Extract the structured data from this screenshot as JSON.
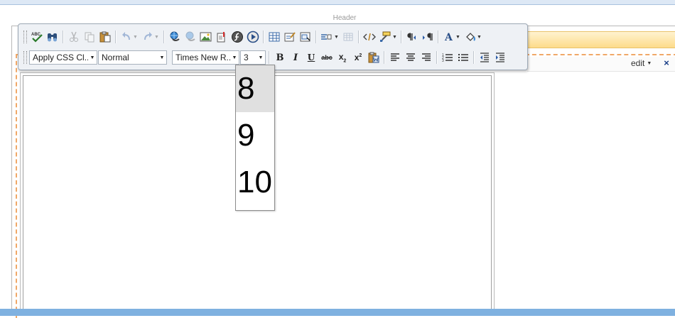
{
  "zone": {
    "header_label": "Header"
  },
  "webpart": {
    "edit_label": "edit",
    "close_symbol": "×"
  },
  "toolbar": {
    "row1_icons": [
      "spellcheck-icon",
      "find-replace-icon",
      "cut-icon",
      "copy-icon",
      "paste-icon",
      "undo-icon",
      "redo-icon",
      "hyperlink-icon",
      "remove-link-icon",
      "image-icon",
      "document-link-icon",
      "flash-icon",
      "media-icon",
      "table-icon",
      "form-icon",
      "form-element-icon",
      "insert-symbol-icon",
      "horizontal-rule-icon",
      "html-source-icon",
      "format-painter-icon",
      "ltr-icon",
      "rtl-icon",
      "font-color-icon",
      "highlight-color-icon"
    ],
    "css_class": {
      "value": "Apply CSS Cl..."
    },
    "paragraph_format": {
      "value": "Normal"
    },
    "font_name": {
      "value": "Times New R..."
    },
    "font_size": {
      "value": "3"
    },
    "bold_glyph": "B",
    "italic_glyph": "I",
    "underline_glyph": "U",
    "strike_glyph": "abc",
    "subscript_glyph": "x",
    "superscript_glyph": "x",
    "sub_mark": "2",
    "sup_mark": "2"
  },
  "font_size_dropdown": {
    "options": [
      "8",
      "9",
      "10"
    ],
    "hovered": "8"
  },
  "colors": {
    "toolbar_bg": "#eef1f5",
    "zone_dashed": "#f0a868",
    "bottom_bar": "#7fb1e0",
    "close_x": "#1a3f88"
  }
}
